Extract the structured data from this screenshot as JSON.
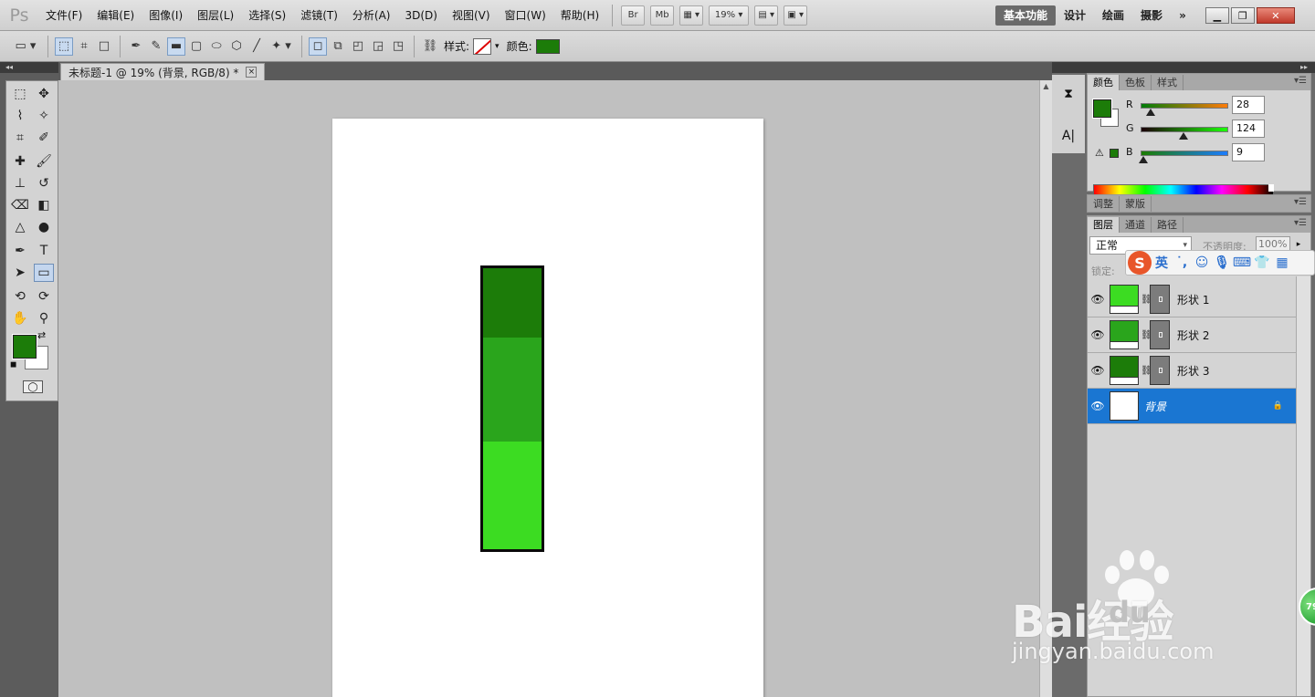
{
  "menubar": {
    "logo": "Ps",
    "items": [
      "文件(F)",
      "编辑(E)",
      "图像(I)",
      "图层(L)",
      "选择(S)",
      "滤镜(T)",
      "分析(A)",
      "3D(D)",
      "视图(V)",
      "窗口(W)",
      "帮助(H)"
    ],
    "bridge": "Br",
    "minibridge": "Mb",
    "zoom": "19%",
    "workspaces": [
      "基本功能",
      "设计",
      "绘画",
      "摄影"
    ],
    "more": "»"
  },
  "optbar": {
    "style_label": "样式:",
    "color_label": "颜色:",
    "color_value": "#1c7c09"
  },
  "document": {
    "tab_title": "未标题-1 @ 19% (背景, RGB/8) *",
    "close_glyph": "×"
  },
  "shapes": [
    {
      "name": "形状 3",
      "color": "#1c7c09"
    },
    {
      "name": "形状 2",
      "color": "#2aa51c"
    },
    {
      "name": "形状 1",
      "color": "#3cdc22"
    }
  ],
  "colors": {
    "foreground": "#1c7c09",
    "background": "#ffffff"
  },
  "color_panel": {
    "tabs": [
      "颜色",
      "色板",
      "样式"
    ],
    "channels": [
      {
        "label": "R",
        "value": "28",
        "fraction": 0.11
      },
      {
        "label": "G",
        "value": "124",
        "fraction": 0.49
      },
      {
        "label": "B",
        "value": "9",
        "fraction": 0.035
      }
    ]
  },
  "adjust_panel": {
    "tabs": [
      "调整",
      "蒙版"
    ]
  },
  "layers_panel": {
    "tabs": [
      "图层",
      "通道",
      "路径"
    ],
    "blend_mode": "正常",
    "opacity_label": "不透明度:",
    "opacity_value": "100%",
    "lock_label": "锁定:",
    "layers": [
      {
        "name": "形状 1",
        "color": "#3cdc22",
        "selected": false
      },
      {
        "name": "形状 2",
        "color": "#2aa51c",
        "selected": false
      },
      {
        "name": "形状 3",
        "color": "#1c7c09",
        "selected": false
      },
      {
        "name": "背景",
        "color": "#ffffff",
        "selected": true
      }
    ]
  },
  "ime": {
    "lang": "英"
  },
  "watermark": {
    "brand": "Bai经验",
    "brand_du": "du",
    "url": "jingyan.baidu.com"
  },
  "badge": "79"
}
